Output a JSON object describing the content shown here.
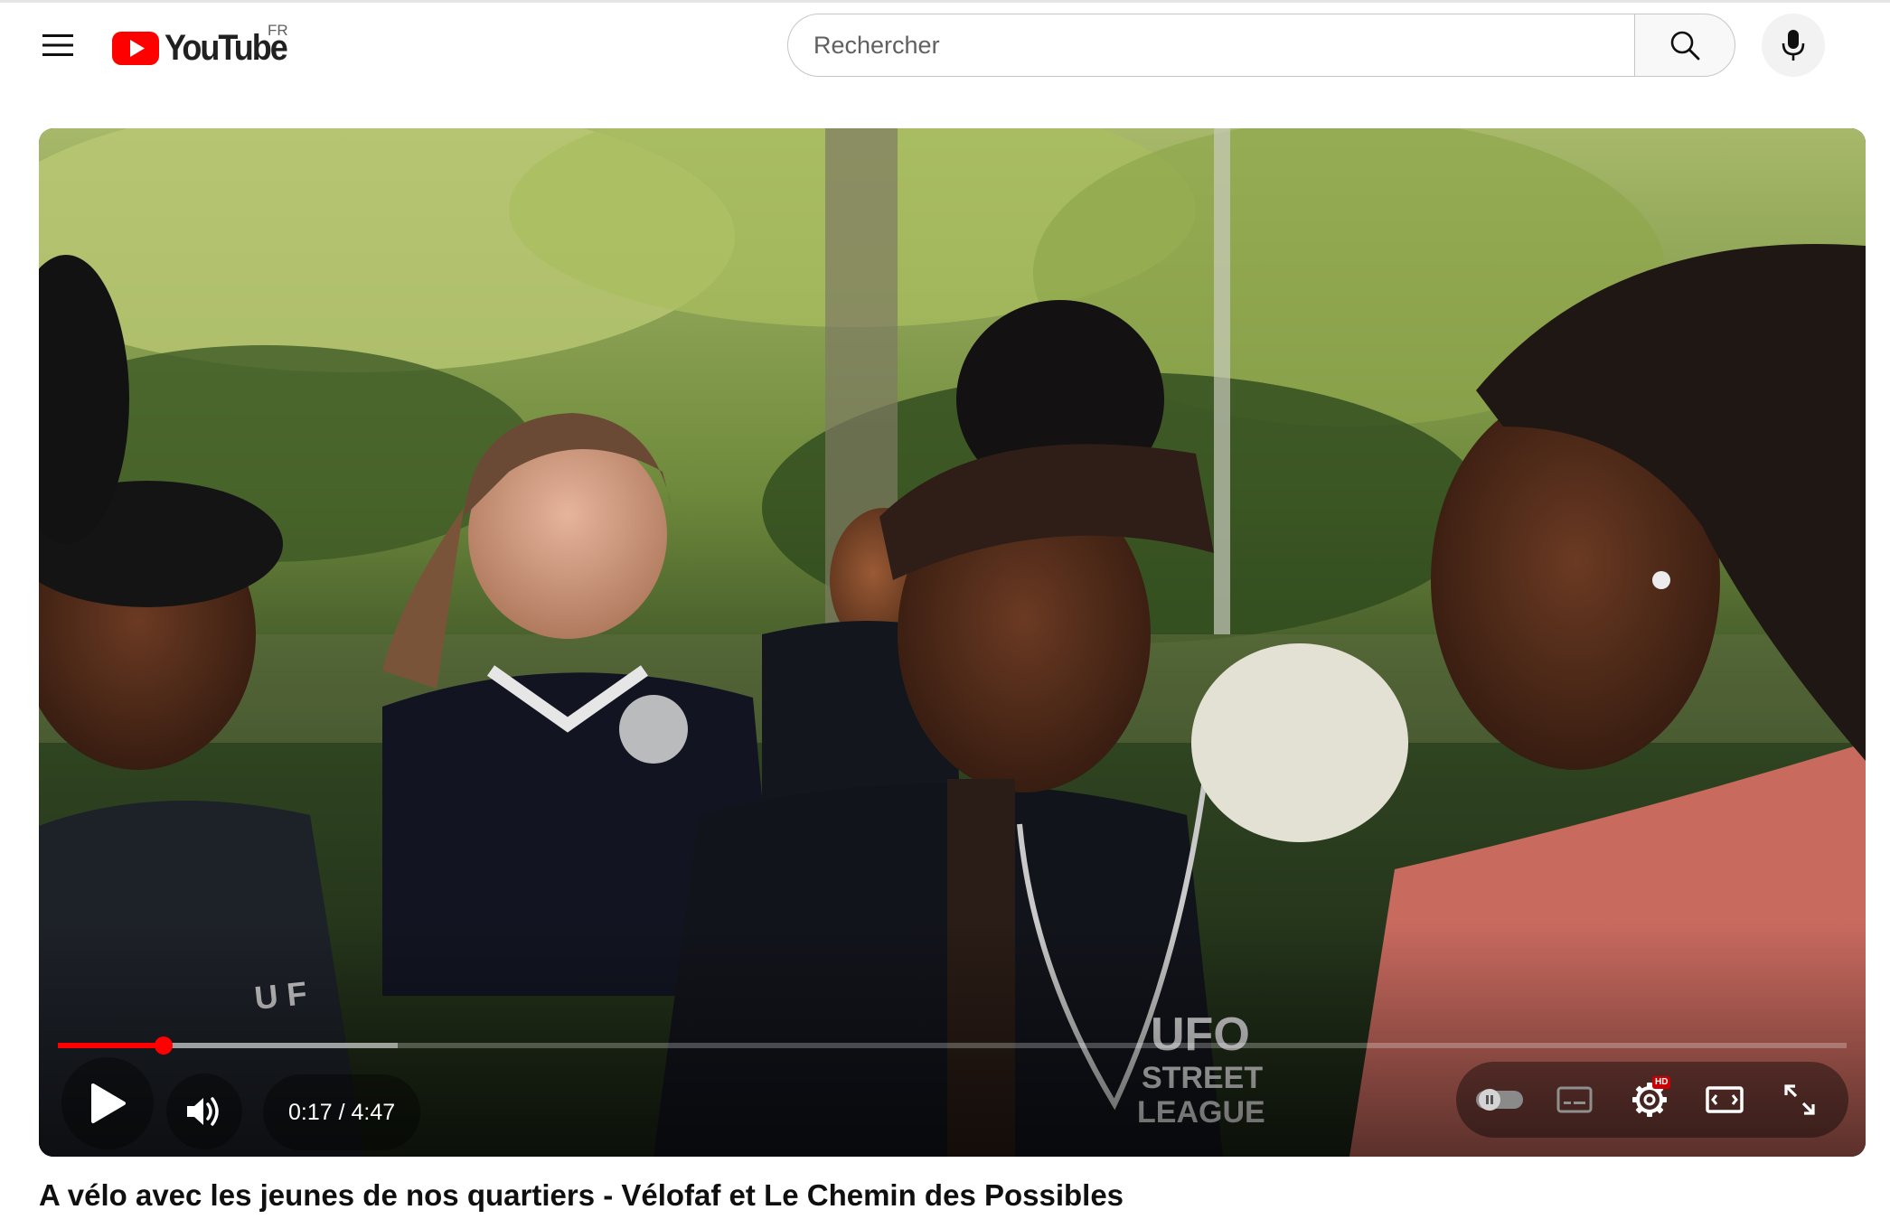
{
  "header": {
    "logo_text": "YouTube",
    "country_code": "FR",
    "search": {
      "placeholder": "Rechercher",
      "value": ""
    },
    "icons": {
      "menu": "hamburger-menu-icon",
      "search": "search-icon",
      "mic": "microphone-icon"
    }
  },
  "player": {
    "current_time": "0:17",
    "separator": " / ",
    "duration": "4:47",
    "progress_fraction": 0.059,
    "buffered_fraction": 0.19,
    "hd_label": "HD",
    "frame_jersey_text": [
      "UFO",
      "STREET",
      "LEAGUE"
    ],
    "colors": {
      "progress": "#ff0000",
      "hd_badge": "#cc0000"
    },
    "controls": {
      "play": "play-icon",
      "volume": "volume-icon",
      "autoplay": "autoplay-toggle-icon",
      "subtitles": "subtitles-icon",
      "settings": "settings-gear-icon",
      "theater": "theater-mode-icon",
      "fullscreen": "fullscreen-icon"
    }
  },
  "video": {
    "title": "A vélo avec les jeunes de nos quartiers - Vélofaf et Le Chemin des Possibles"
  }
}
